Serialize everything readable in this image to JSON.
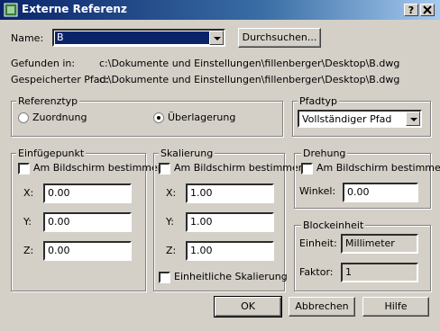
{
  "window": {
    "title": "Externe Referenz",
    "help_label": "?",
    "close_label": "X"
  },
  "name": {
    "label": "Name:",
    "value": "B",
    "browse_label": "Durchsuchen..."
  },
  "found": {
    "label": "Gefunden in:",
    "value": "c:\\Dokumente und Einstellungen\\fillenberger\\Desktop\\B.dwg"
  },
  "saved": {
    "label": "Gespeicherter Pfad:",
    "value": "c:\\Dokumente und Einstellungen\\fillenberger\\Desktop\\B.dwg"
  },
  "reftype": {
    "title": "Referenztyp",
    "options": [
      "Zuordnung",
      "Überlagerung"
    ],
    "selected": "Überlagerung"
  },
  "pathtype": {
    "title": "Pfadtyp",
    "value": "Vollständiger Pfad"
  },
  "insertion": {
    "title": "Einfügepunkt",
    "onscreen_label": "Am Bildschirm bestimmen",
    "x_label": "X:",
    "y_label": "Y:",
    "z_label": "Z:",
    "x": "0.00",
    "y": "0.00",
    "z": "0.00"
  },
  "scale": {
    "title": "Skalierung",
    "onscreen_label": "Am Bildschirm bestimmen",
    "x_label": "X:",
    "y_label": "Y:",
    "z_label": "Z:",
    "x": "1.00",
    "y": "1.00",
    "z": "1.00",
    "uniform_label": "Einheitliche Skalierung"
  },
  "rotation": {
    "title": "Drehung",
    "onscreen_label": "Am Bildschirm bestimmen",
    "angle_label": "Winkel:",
    "angle": "0.00"
  },
  "block": {
    "title": "Blockeinheit",
    "unit_label": "Einheit:",
    "unit": "Millimeter",
    "factor_label": "Faktor:",
    "factor": "1"
  },
  "buttons": {
    "ok": "OK",
    "cancel": "Abbrechen",
    "help": "Hilfe"
  }
}
